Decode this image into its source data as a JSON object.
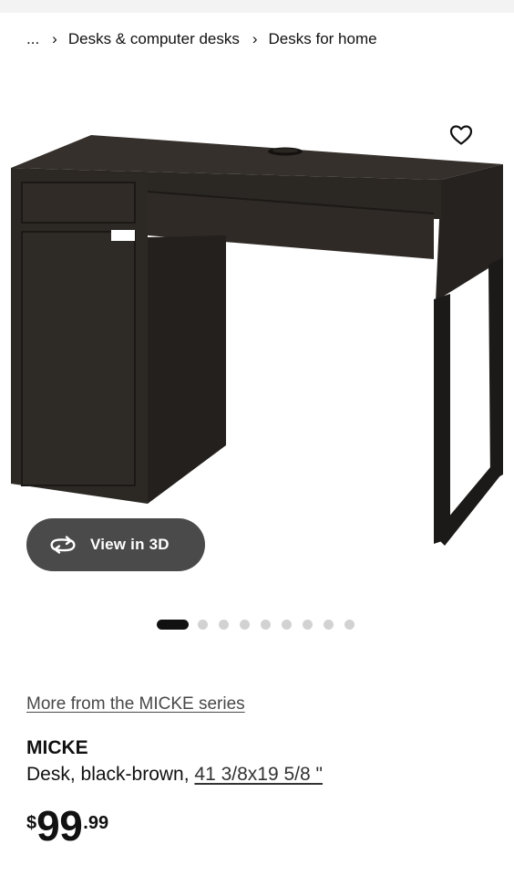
{
  "breadcrumb": {
    "more": "...",
    "separator": "›",
    "items": [
      "Desks & computer desks",
      "Desks for home"
    ]
  },
  "gallery": {
    "favorite_icon": "heart-outline-icon",
    "view_3d_icon": "rotate-3d-icon",
    "view_3d_label": "View in 3D",
    "image_count": 9,
    "active_index": 0
  },
  "product": {
    "series_link": "More from the MICKE series",
    "name": "MICKE",
    "description": "Desk, black-brown, ",
    "dimensions": "41 3/8x19 5/8 \"",
    "price": {
      "currency": "$",
      "integer": "99",
      "decimal": ".99"
    }
  },
  "colors": {
    "desk": "#2e2a26",
    "button_bg": "#4a4a4a",
    "dot_inactive": "#d2d2d2",
    "dot_active": "#111111"
  }
}
